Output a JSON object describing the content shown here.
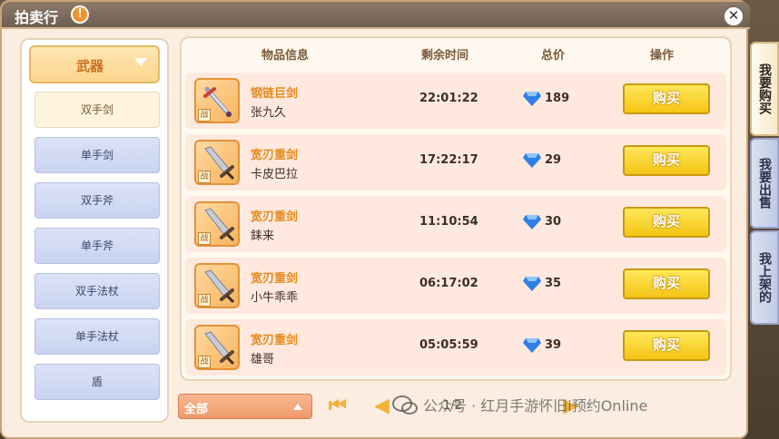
{
  "window": {
    "title": "拍卖行",
    "warn_symbol": "!",
    "close_symbol": "✕"
  },
  "category": {
    "selected": "武器",
    "items": [
      {
        "label": "双手剑",
        "active": true
      },
      {
        "label": "单手剑",
        "active": false
      },
      {
        "label": "双手斧",
        "active": false
      },
      {
        "label": "单手斧",
        "active": false
      },
      {
        "label": "双手法杖",
        "active": false
      },
      {
        "label": "单手法杖",
        "active": false
      },
      {
        "label": "盾",
        "active": false
      }
    ]
  },
  "table": {
    "headers": {
      "item": "物品信息",
      "time": "剩余时间",
      "price": "总价",
      "action": "操作"
    },
    "rows": [
      {
        "name": "钢链巨剑",
        "seller": "张九久",
        "time": "22:01:22",
        "price": "189",
        "button": "购买",
        "badge": "战",
        "icon": "chain-greatsword-icon"
      },
      {
        "name": "宽刃重剑",
        "seller": "卡皮巴拉",
        "time": "17:22:17",
        "price": "29",
        "button": "购买",
        "badge": "战",
        "icon": "broadsword-icon"
      },
      {
        "name": "宽刃重剑",
        "seller": "銇来",
        "time": "11:10:54",
        "price": "30",
        "button": "购买",
        "badge": "战",
        "icon": "broadsword-icon"
      },
      {
        "name": "宽刃重剑",
        "seller": "小牛乖乖",
        "time": "06:17:02",
        "price": "35",
        "button": "购买",
        "badge": "战",
        "icon": "broadsword-icon"
      },
      {
        "name": "宽刃重剑",
        "seller": "雄哥",
        "time": "05:05:59",
        "price": "39",
        "button": "购买",
        "badge": "战",
        "icon": "broadsword-icon"
      }
    ]
  },
  "side_tabs": [
    {
      "label": "我要购买",
      "active": true
    },
    {
      "label": "我要出售",
      "active": false
    },
    {
      "label": "我上架的",
      "active": false
    }
  ],
  "footer": {
    "filter_label": "全部",
    "first_symbol": "⏮",
    "prev_symbol": "◀",
    "page": "1/2",
    "next_symbol": "▶",
    "watermark": "公众号 · 红月手游怀旧i预约Online"
  },
  "colors": {
    "accent": "#f4c414",
    "item_name": "#e58a1f",
    "diamond": "#2f7fe8"
  }
}
